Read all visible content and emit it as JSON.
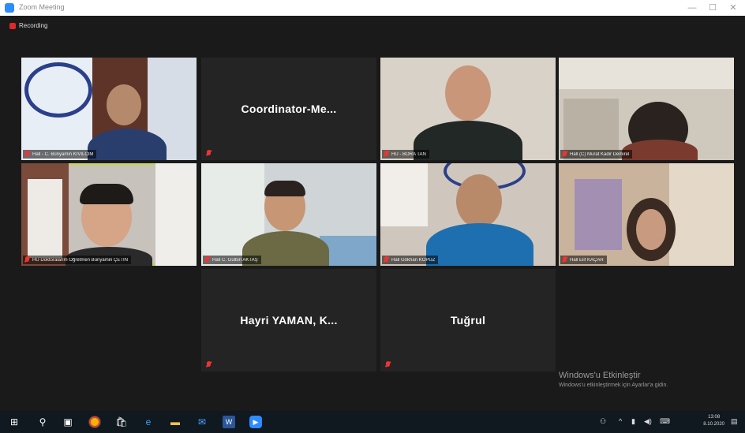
{
  "window": {
    "title": "Zoom Meeting",
    "controls": [
      "—",
      "☐",
      "✕"
    ]
  },
  "recording": {
    "label": "Recording"
  },
  "participants": [
    {
      "name": "Hall - C. Bünyamin KIVILCIM",
      "video": true
    },
    {
      "name": "Coordinator-Me...",
      "video": false
    },
    {
      "name": "HU - BORA TAN",
      "video": true
    },
    {
      "name": "Hall (C) Murat Kadir Demirel",
      "video": true
    },
    {
      "name": "HU Doktoralarım Öğretmen Bünyamin ÇETİN",
      "video": true,
      "speaking": true
    },
    {
      "name": "Hall C. Gülbin AKTAŞ",
      "video": true
    },
    {
      "name": "Hall Gökhan KOPUZ",
      "video": true
    },
    {
      "name": "Hall Elif KAÇAR",
      "video": true
    },
    {
      "name": "Hayri YAMAN, K...",
      "video": false
    },
    {
      "name": "Tuğrul",
      "video": false
    }
  ],
  "watermark": {
    "line1": "Windows'u Etkinleştir",
    "line2": "Windows'u etkinleştirmek için Ayarlar'a gidin."
  },
  "taskbar": {
    "icons": [
      "windows-start-icon",
      "search-icon",
      "task-view-icon",
      "chrome-icon",
      "store-icon",
      "edge-icon",
      "file-explorer-icon",
      "mail-icon",
      "word-icon",
      "zoom-icon"
    ],
    "time": "13:08",
    "date": "8.10.2020"
  },
  "colors": {
    "active_speaker": "#c7d93a",
    "muted_mic": "#e33333",
    "zoom_blue": "#2d8cff"
  }
}
